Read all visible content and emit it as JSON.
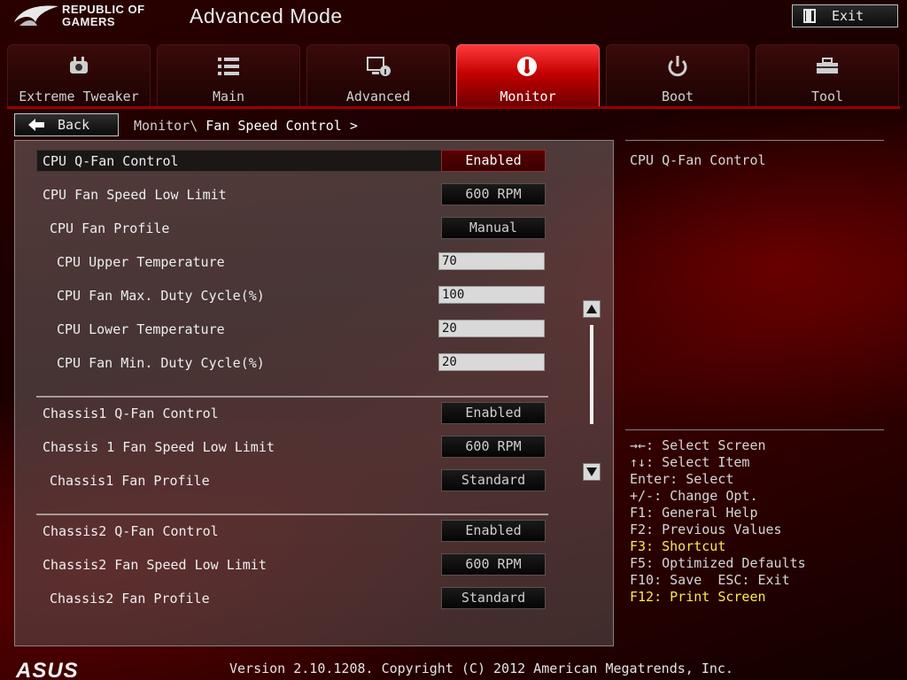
{
  "header": {
    "brand_line1": "REPUBLIC OF",
    "brand_line2": "GAMERS",
    "mode_title": "Advanced Mode",
    "exit_label": "Exit"
  },
  "tabs": [
    {
      "label": "Extreme Tweaker",
      "icon": "tweaker-icon",
      "active": false
    },
    {
      "label": "Main",
      "icon": "list-icon",
      "active": false
    },
    {
      "label": "Advanced",
      "icon": "advanced-icon",
      "active": false
    },
    {
      "label": "Monitor",
      "icon": "monitor-icon",
      "active": true
    },
    {
      "label": "Boot",
      "icon": "power-icon",
      "active": false
    },
    {
      "label": "Tool",
      "icon": "toolbox-icon",
      "active": false
    }
  ],
  "nav": {
    "back_label": "Back",
    "breadcrumb_parent": "Monitor\\",
    "breadcrumb_current": " Fan Speed Control >"
  },
  "settings": {
    "cpu_qfan": {
      "label": "CPU Q-Fan Control",
      "value": "Enabled"
    },
    "cpu_low_limit": {
      "label": "CPU Fan Speed Low Limit",
      "value": "600 RPM"
    },
    "cpu_profile": {
      "label": "CPU Fan Profile",
      "value": "Manual"
    },
    "cpu_upper_temp": {
      "label": "CPU Upper Temperature",
      "value": "70"
    },
    "cpu_max_duty": {
      "label": "CPU Fan Max. Duty Cycle(%)",
      "value": "100"
    },
    "cpu_lower_temp": {
      "label": "CPU Lower Temperature",
      "value": "20"
    },
    "cpu_min_duty": {
      "label": "CPU Fan Min. Duty Cycle(%)",
      "value": "20"
    },
    "ch1_qfan": {
      "label": "Chassis1 Q-Fan Control",
      "value": "Enabled"
    },
    "ch1_low_limit": {
      "label": "Chassis 1 Fan Speed Low Limit",
      "value": "600 RPM"
    },
    "ch1_profile": {
      "label": "Chassis1 Fan Profile",
      "value": "Standard"
    },
    "ch2_qfan": {
      "label": "Chassis2 Q-Fan Control",
      "value": "Enabled"
    },
    "ch2_low_limit": {
      "label": "Chassis2 Fan Speed Low Limit",
      "value": "600 RPM"
    },
    "ch2_profile": {
      "label": "Chassis2 Fan Profile",
      "value": "Standard"
    }
  },
  "help": {
    "title": "CPU Q-Fan Control",
    "keys": [
      "→←: Select Screen",
      "↑↓: Select Item",
      "Enter: Select",
      "+/-: Change Opt.",
      "F1: General Help",
      "F2: Previous Values",
      "F3: Shortcut",
      "F5: Optimized Defaults",
      "F10: Save  ESC: Exit",
      "F12: Print Screen"
    ]
  },
  "footer": {
    "logo_text": "ASUS",
    "version": "Version 2.10.1208. Copyright (C) 2012 American Megatrends, Inc."
  },
  "colors": {
    "accent_red": "#c40000",
    "highlight_yellow": "#ffe84a"
  }
}
